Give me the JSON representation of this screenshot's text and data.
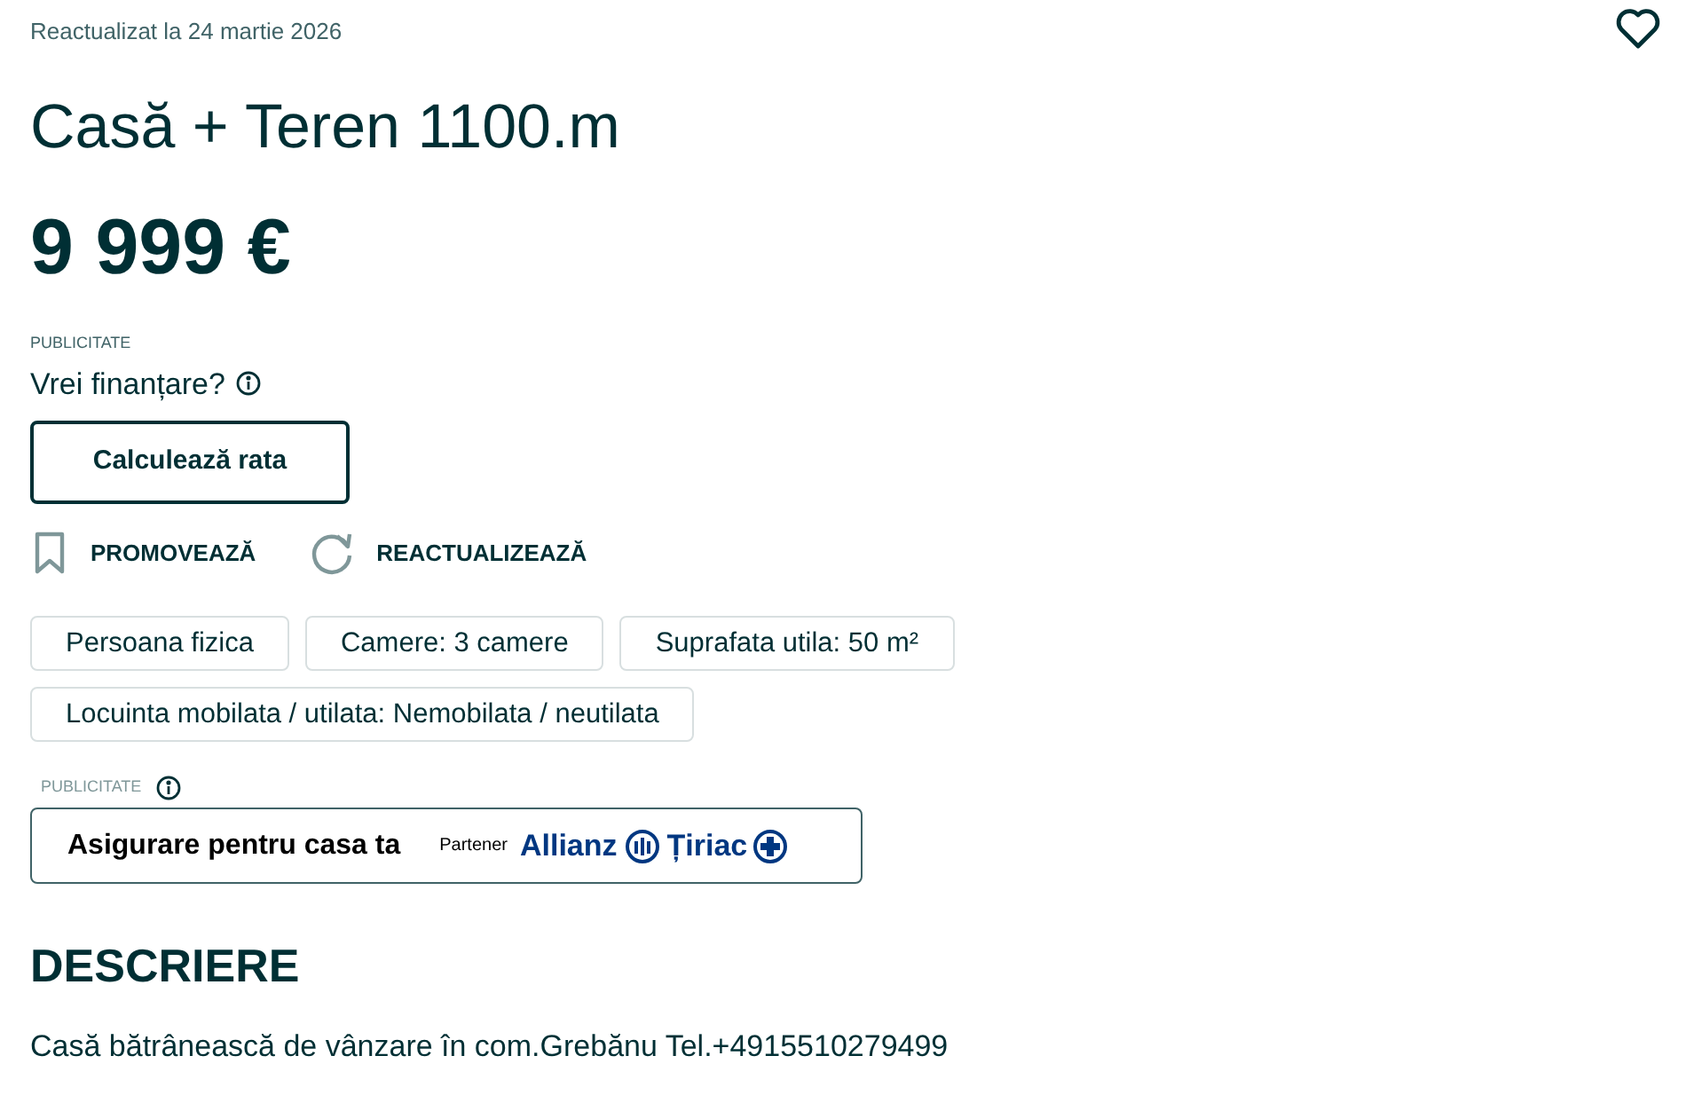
{
  "updated": "Reactualizat la 24 martie 2026",
  "title": "Casă + Teren 1100.m",
  "price": "9 999 €",
  "financing": {
    "ad_label": "PUBLICITATE",
    "question": "Vrei finanțare?",
    "button": "Calculează rata"
  },
  "actions": [
    {
      "kind": "promote",
      "label": "PROMOVEAZĂ"
    },
    {
      "kind": "refresh",
      "label": "REACTUALIZEAZĂ"
    }
  ],
  "tags": [
    "Persoana fizica",
    "Camere: 3 camere",
    "Suprafata utila: 50 m²",
    "Locuinta mobilata / utilata: Nemobilata / neutilata"
  ],
  "insurance": {
    "ad_label": "PUBLICITATE",
    "text": "Asigurare pentru casa ta",
    "partner": "Partener",
    "logo_left": "Allianz",
    "logo_right": "Țiriac"
  },
  "description": {
    "heading": "DESCRIERE",
    "text": "Casă bătrânească de vânzare în com.Grebănu Tel.+4915510279499"
  }
}
